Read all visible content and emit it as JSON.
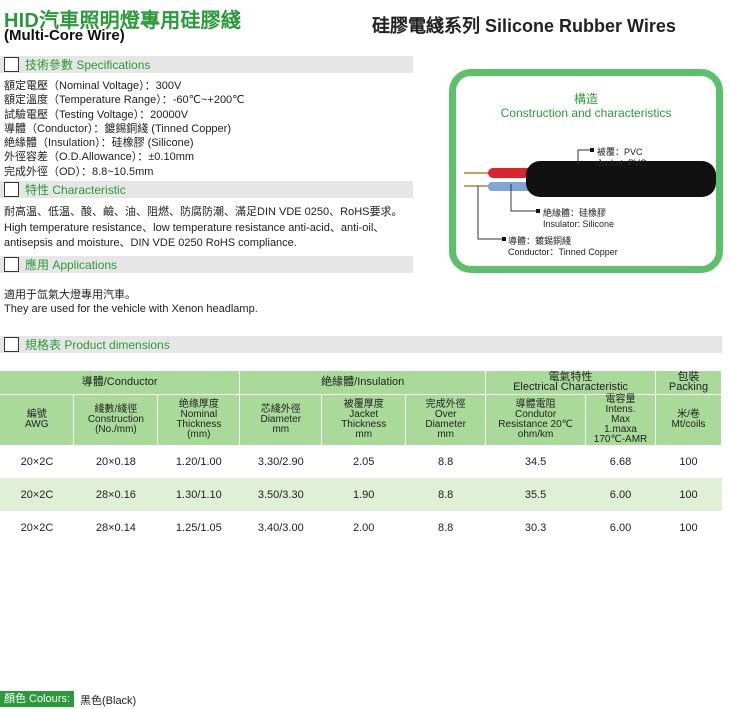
{
  "header": {
    "title": "HID汽車照明燈專用硅膠綫",
    "subtitle": "(Multi-Core Wire)",
    "series": "硅膠電綫系列 Silicone Rubber Wires"
  },
  "specifications": {
    "heading": "技術參數 Specifications",
    "lines": [
      "額定電壓（Nominal Voltage）：300V",
      "額定溫度（Temperature Range）：-60℃~+200℃",
      "試驗電壓（Testing Voltage）：20000V",
      "導體（Conductor）：鍍錫銅綫 (Tinned Copper)",
      "絶緣體（Insulation）：硅橡膠 (Silicone)",
      "外徑容差（O.D.Allowance）：±0.10mm",
      "完成外徑（OD）：8.8~10.5mm"
    ]
  },
  "characteristic": {
    "heading": "特性 Characteristic",
    "lines": [
      "耐高温、低温、酸、鹼、油、阻燃、防腐防潮、滿足DIN VDE 0250、RoHS要求。",
      "High temperature resistance、low temperature resistance anti-acid、anti-oil、",
      "antisepsis and moisture、DIN VDE 0250 RoHS compliance."
    ]
  },
  "applications": {
    "heading": "應用 Applications",
    "lines": [
      "適用于氙氣大燈專用汽車。",
      "They are used for the vehicle with Xenon headlamp."
    ]
  },
  "dimensions_heading": "規格表 Product dimensions",
  "diagram": {
    "title_cn": "構造",
    "title_en": "Construction and characteristics",
    "jacket_cn": "被覆：PVC",
    "jacket_en": "Jacket: PVC",
    "insulator_cn": "絶緣體：硅橡膠",
    "insulator_en": "Insulator: Silicone",
    "conductor_cn": "導體：鍍錫銅綫",
    "conductor_en": "Conductor：Tinned Copper",
    "colors": {
      "frame": "#5cc16a",
      "jacket": "#111111",
      "core_red": "#d9262e",
      "core_blue": "#7fa7d6",
      "copper": "#c9a06a"
    }
  },
  "table": {
    "groups": {
      "conductor": "導體/Conductor",
      "insulation": "絶緣體/Insulation",
      "electrical_cn": "電氣特性",
      "electrical_en": "Electrical Characteristic",
      "packing_cn": "包裝",
      "packing_en": "Packing"
    },
    "subheaders": {
      "awg": [
        "編號",
        "AWG"
      ],
      "construction": [
        "綫數/綫徑",
        "Construction",
        "(No./mm)"
      ],
      "nominal": [
        "绝缘厚度",
        "Nominal",
        "Thickness",
        "(mm)"
      ],
      "diameter": [
        "芯綫外徑",
        "Diameter",
        "mm"
      ],
      "jacket": [
        "被覆厚度",
        "Jacket",
        "Thickness",
        "mm"
      ],
      "over": [
        "完成外徑",
        "Over",
        "Diameter",
        "mm"
      ],
      "resistance": [
        "導體電阻",
        "Condutor",
        "Resistance 20℃",
        "ohm/km"
      ],
      "intens": [
        "電容量",
        "Intens.",
        "Max",
        "1.maxa",
        "170℃-AMR"
      ],
      "packing": [
        "米/卷",
        "Mt/coils"
      ]
    },
    "rows": [
      [
        "20×2C",
        "20×0.18",
        "1.20/1.00",
        "3.30/2.90",
        "2.05",
        "8.8",
        "34.5",
        "6.68",
        "100"
      ],
      [
        "20×2C",
        "28×0.16",
        "1.30/1.10",
        "3.50/3.30",
        "1.90",
        "8.8",
        "35.5",
        "6.00",
        "100"
      ],
      [
        "20×2C",
        "28×0.14",
        "1.25/1.05",
        "3.40/3.00",
        "2.00",
        "8.8",
        "30.3",
        "6.00",
        "100"
      ]
    ]
  },
  "colour": {
    "label": "顏色 Colours:",
    "value": "黑色(Black)"
  }
}
